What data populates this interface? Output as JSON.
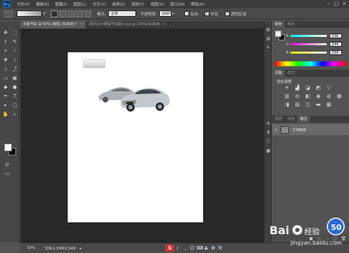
{
  "app": {
    "logo": "Ps",
    "menu": [
      "文件(F)",
      "编辑(E)",
      "图像(I)",
      "图层(L)",
      "文字(Y)",
      "选择(S)",
      "滤镜(T)",
      "视图(V)",
      "窗口(W)",
      "帮助(H)"
    ],
    "window_controls": [
      "–",
      "□",
      "×"
    ]
  },
  "options_bar": {
    "mode_label": "模式:",
    "mode_value": "正常",
    "opacity_label": "不透明度:",
    "opacity_value": "100%",
    "reverse_label": "反向",
    "dither_label": "仿色",
    "transparency_label": "透明区域",
    "reverse_checked": false,
    "dither_checked": true,
    "transparency_checked": true
  },
  "tabs": [
    {
      "label": "华晨汽车 @ 50% (按钮, RGB/8) *",
      "active": true
    },
    {
      "label": "网页设计课程汽车图片.jpg @ 100%(RGB/8)",
      "active": false
    }
  ],
  "color_panel": {
    "tabs": [
      "颜色",
      "色板"
    ],
    "channels": [
      {
        "name": "R",
        "value": "236"
      },
      {
        "name": "G",
        "value": "244"
      },
      {
        "name": "B",
        "value": "234"
      }
    ]
  },
  "adjust_panel": {
    "tabs": [
      "调整",
      "样式"
    ],
    "title": "添加调整",
    "icons": [
      "brightness-icon",
      "levels-icon",
      "curves-icon",
      "exposure-icon",
      "vibrance-icon",
      "hue-sat-icon",
      "color-balance-icon",
      "bw-icon",
      "photo-filter-icon",
      "channel-mixer-icon",
      "color-lookup-icon",
      "invert-icon",
      "posterize-icon",
      "threshold-icon",
      "gradient-map-icon",
      "selective-color-icon"
    ]
  },
  "layers_panel": {
    "tabs": [
      "图层",
      "通道",
      "路径"
    ],
    "layer_name": "工作路径"
  },
  "status": {
    "zoom": "50%",
    "doc_info": "文档:2.29M/1.54M"
  },
  "taskbar": {
    "s_label": "S",
    "s_color": "#d8322b"
  },
  "watermark": {
    "text": "jingyan.baidu.com"
  }
}
